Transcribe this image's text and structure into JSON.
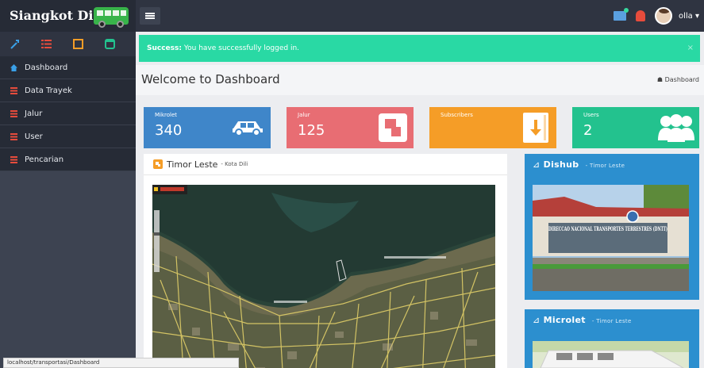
{
  "app": {
    "brand": "Siangkot Dili",
    "user_name": "olla ▾"
  },
  "sidebar": {
    "items": [
      {
        "label": "Dashboard",
        "icon": "home-icon"
      },
      {
        "label": "Data Trayek",
        "icon": "list-icon"
      },
      {
        "label": "Jalur",
        "icon": "list-icon"
      },
      {
        "label": "User",
        "icon": "list-icon"
      },
      {
        "label": "Pencarian",
        "icon": "list-icon"
      }
    ]
  },
  "alert": {
    "strong": "Success:",
    "message": " You have successfully logged in.",
    "close": "×"
  },
  "page": {
    "title": "Welcome to Dashboard",
    "breadcrumb": "Dashboard"
  },
  "stats": [
    {
      "label": "Mikrolet",
      "value": "340",
      "color": "#3f86c9",
      "icon": "car-icon"
    },
    {
      "label": "Jalur",
      "value": "125",
      "color": "#e86d73",
      "icon": "jalur-icon"
    },
    {
      "label": "Subscribers",
      "value": "",
      "color": "#f59d27",
      "icon": "file-download-icon"
    },
    {
      "label": "Users",
      "value": "2",
      "color": "#23c28e",
      "icon": "users-icon"
    }
  ],
  "map_panel": {
    "title": "Timor Leste",
    "subtitle": "- Kota Dili"
  },
  "side_panels": [
    {
      "title": "Dishub",
      "subtitle": "- Timor Leste",
      "sign_text": "DIRECCAO NACIONAL TRANSPORTES TERRESTRES (DNTT)"
    },
    {
      "title": "Microlet",
      "subtitle": "- Timor Leste"
    }
  ],
  "status_bar": {
    "url": "localhost/transportasi/Dashboard"
  }
}
